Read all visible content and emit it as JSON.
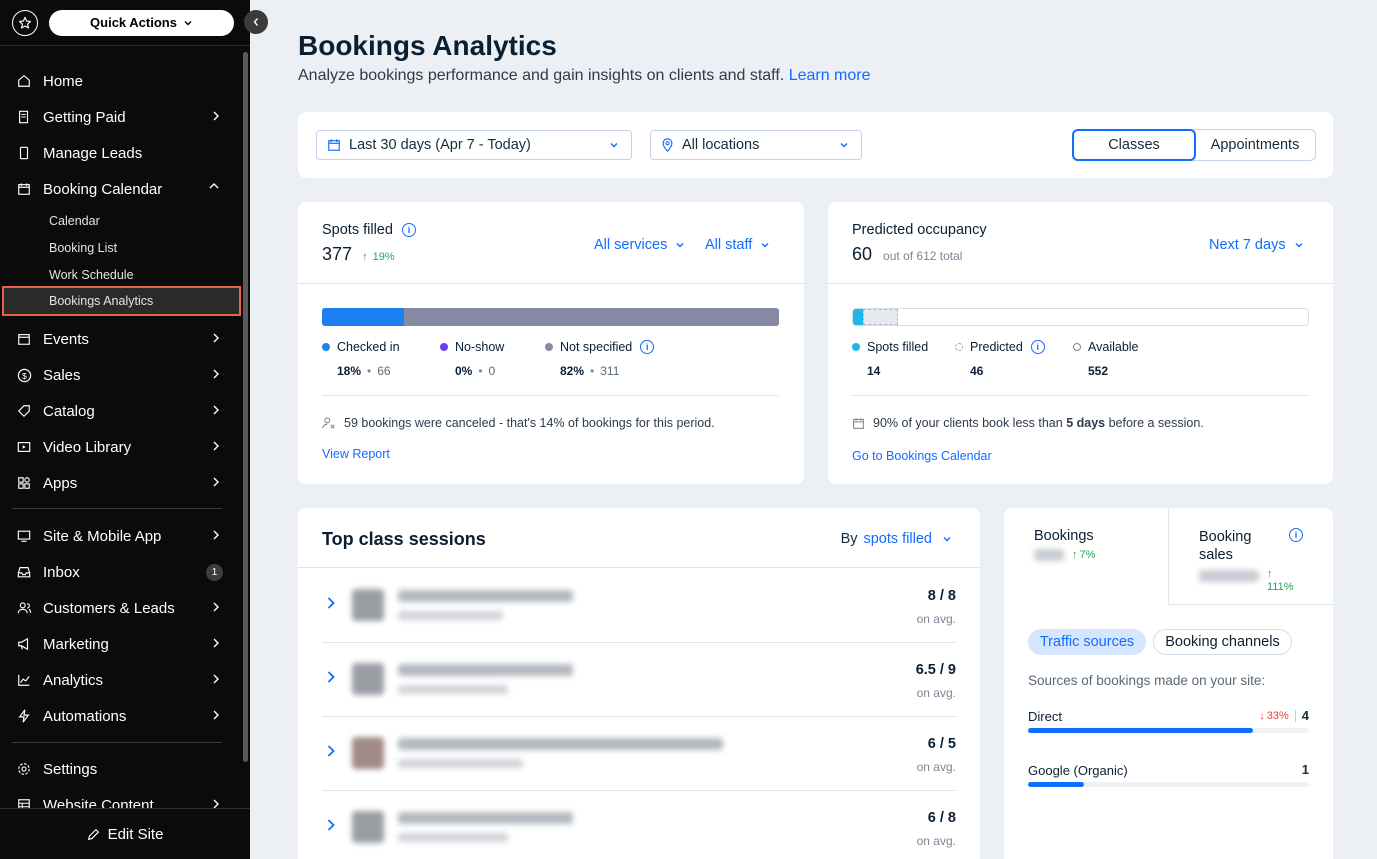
{
  "sidebar": {
    "quick_actions": "Quick Actions",
    "items": [
      {
        "label": "Home",
        "icon": "home-icon"
      },
      {
        "label": "Getting Paid",
        "icon": "receipt-icon"
      },
      {
        "label": "Manage Leads",
        "icon": "mobile-icon"
      },
      {
        "label": "Booking Calendar",
        "icon": "calendar-icon"
      },
      {
        "label": "Events",
        "icon": "events-calendar-icon"
      },
      {
        "label": "Sales",
        "icon": "dollar-icon"
      },
      {
        "label": "Catalog",
        "icon": "tag-icon"
      },
      {
        "label": "Video Library",
        "icon": "video-icon"
      },
      {
        "label": "Apps",
        "icon": "apps-icon"
      },
      {
        "label": "Site & Mobile App",
        "icon": "site-icon"
      },
      {
        "label": "Inbox",
        "icon": "inbox-icon"
      },
      {
        "label": "Customers & Leads",
        "icon": "people-icon"
      },
      {
        "label": "Marketing",
        "icon": "megaphone-icon"
      },
      {
        "label": "Analytics",
        "icon": "chart-icon"
      },
      {
        "label": "Automations",
        "icon": "bolt-icon"
      },
      {
        "label": "Settings",
        "icon": "gear-icon"
      },
      {
        "label": "Website Content",
        "icon": "table-icon"
      }
    ],
    "sub_items": [
      "Calendar",
      "Booking List",
      "Work Schedule",
      "Bookings Analytics"
    ],
    "inbox_badge": "1",
    "edit_site": "Edit Site"
  },
  "header": {
    "title": "Bookings Analytics",
    "subtitle": "Analyze bookings performance and gain insights on clients and staff.",
    "learn_more": "Learn more"
  },
  "filters": {
    "date_range": "Last 30 days (Apr 7 - Today)",
    "location": "All locations",
    "toggle": [
      "Classes",
      "Appointments"
    ],
    "active_toggle": "Classes"
  },
  "spots": {
    "title": "Spots filled",
    "value": "377",
    "change": "19%",
    "services_dd": "All services",
    "staff_dd": "All staff",
    "segments": [
      {
        "label": "Checked in",
        "pct": "18%",
        "count": "66",
        "color": "#1d7ff0",
        "fraction": 0.18
      },
      {
        "label": "No-show",
        "pct": "0%",
        "count": "0",
        "color": "#6a3df5",
        "fraction": 0
      },
      {
        "label": "Not specified",
        "pct": "82%",
        "count": "311",
        "color": "#868aa5",
        "fraction": 0.82
      }
    ],
    "canceled_note": "59 bookings were canceled - that's 14% of bookings for this period.",
    "link": "View Report"
  },
  "occupancy": {
    "title": "Predicted occupancy",
    "value": "60",
    "total": "out of 612 total",
    "period_dd": "Next 7 days",
    "items": [
      {
        "label": "Spots filled",
        "value": "14"
      },
      {
        "label": "Predicted",
        "value": "46"
      },
      {
        "label": "Available",
        "value": "552"
      }
    ],
    "note_pct": "90%",
    "note_mid": " of your clients book less than ",
    "note_days": "5 days",
    "note_end": " before a session.",
    "link": "Go to Bookings Calendar"
  },
  "top_sessions": {
    "title": "Top class sessions",
    "by_label": "By",
    "by_value": "spots filled",
    "avg_label": "on avg.",
    "rows": [
      {
        "value": "8 / 8"
      },
      {
        "value": "6.5 / 9"
      },
      {
        "value": "6 / 5"
      },
      {
        "value": "6 / 8"
      }
    ]
  },
  "bookings_panel": {
    "tab1_title": "Bookings",
    "tab1_change": "7%",
    "tab2_title": "Booking sales",
    "tab2_change": "111%",
    "pills": [
      "Traffic sources",
      "Booking channels"
    ],
    "sources_title": "Sources of bookings made on your site:",
    "sources": [
      {
        "label": "Direct",
        "change": "33%",
        "value": "4",
        "fraction": 0.8
      },
      {
        "label": "Google (Organic)",
        "value": "1",
        "fraction": 0.2
      }
    ]
  },
  "colors": {
    "accent": "#116dff",
    "highlight": "#e8624a",
    "up": "#22a559",
    "down": "#e6453a"
  }
}
